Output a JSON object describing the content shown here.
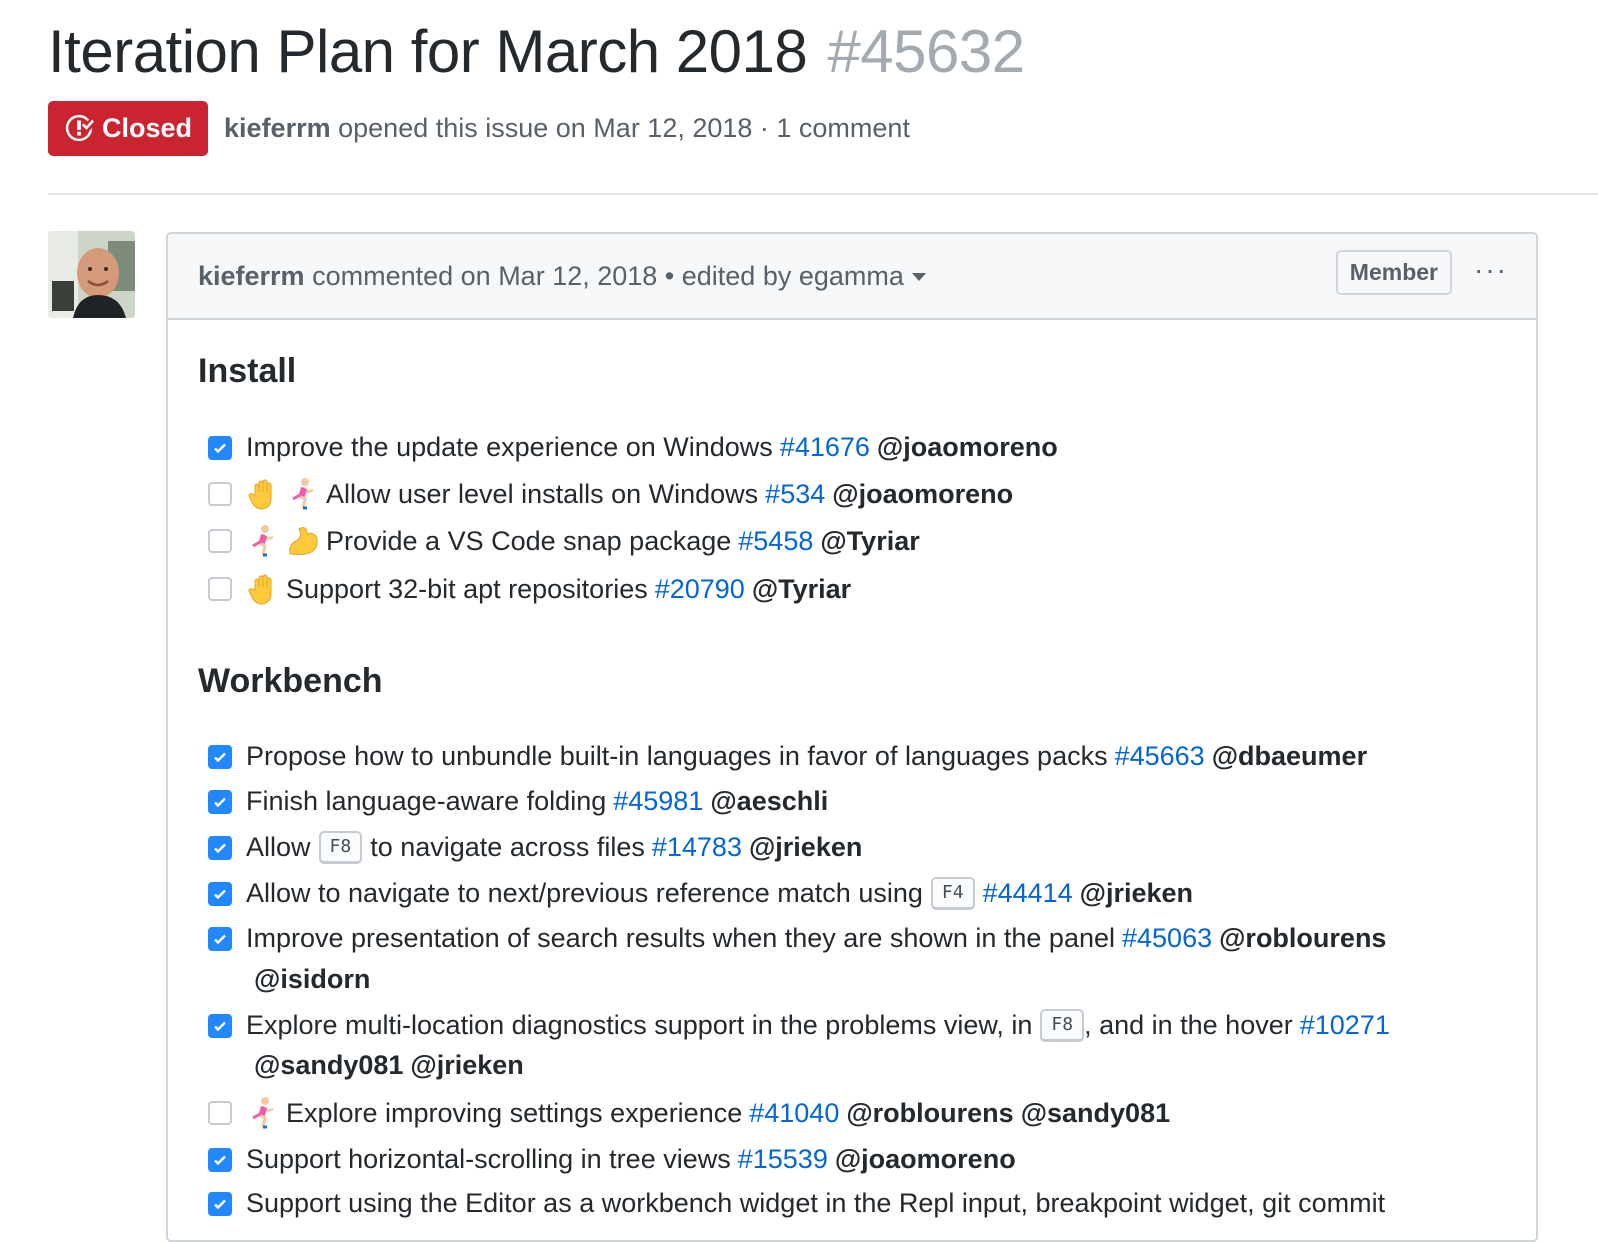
{
  "issue": {
    "title": "Iteration Plan for March 2018",
    "number": "#45632",
    "state": "Closed",
    "author": "kieferrm",
    "opened_text": "opened this issue on Mar 12, 2018 · 1 comment"
  },
  "comment": {
    "author": "kieferrm",
    "header_text": "commented on Mar 12, 2018 • edited by egamma",
    "badge": "Member",
    "more_icon": "more-dots-icon"
  },
  "sections": {
    "install": {
      "title": "Install",
      "tasks": [
        {
          "checked": true,
          "text": "Improve the update experience on Windows",
          "issue": "#41676",
          "mentions": [
            "@joaomoreno"
          ]
        },
        {
          "checked": false,
          "emojis": [
            "raised-hand-icon",
            "runner-icon"
          ],
          "text": "Allow user level installs on Windows",
          "issue": "#534",
          "mentions": [
            "@joaomoreno"
          ]
        },
        {
          "checked": false,
          "emojis": [
            "runner-icon",
            "flexed-biceps-icon"
          ],
          "text": "Provide a VS Code snap package",
          "issue": "#5458",
          "mentions": [
            "@Tyriar"
          ]
        },
        {
          "checked": false,
          "emojis": [
            "raised-hand-icon"
          ],
          "text": "Support 32-bit apt repositories",
          "issue": "#20790",
          "mentions": [
            "@Tyriar"
          ]
        }
      ]
    },
    "workbench": {
      "title": "Workbench",
      "tasks": [
        {
          "checked": true,
          "text": "Propose how to unbundle built-in languages in favor of languages packs",
          "issue": "#45663",
          "mentions": [
            "@dbaeumer"
          ]
        },
        {
          "checked": true,
          "text": "Finish language-aware folding",
          "issue": "#45981",
          "mentions": [
            "@aeschli"
          ]
        },
        {
          "checked": true,
          "text_before": "Allow",
          "key": "F8",
          "text_after": "to navigate across files",
          "issue": "#14783",
          "mentions": [
            "@jrieken"
          ]
        },
        {
          "checked": true,
          "text": "Allow to navigate to next/previous reference match using",
          "key": "F4",
          "issue": "#44414",
          "mentions": [
            "@jrieken"
          ]
        },
        {
          "checked": true,
          "text": "Improve presentation of search results when they are shown in the panel",
          "issue": "#45063",
          "mentions": [
            "@roblourens",
            "@isidorn"
          ]
        },
        {
          "checked": true,
          "text_before": "Explore multi-location diagnostics support in the problems view, in",
          "key": "F8",
          "text_after": ", and in the hover",
          "issue": "#10271",
          "mentions": [
            "@sandy081",
            "@jrieken"
          ]
        },
        {
          "checked": false,
          "emojis": [
            "runner-icon"
          ],
          "text": "Explore improving settings experience",
          "issue": "#41040",
          "mentions": [
            "@roblourens",
            "@sandy081"
          ]
        },
        {
          "checked": true,
          "text": "Support horizontal-scrolling in tree views",
          "issue": "#15539",
          "mentions": [
            "@joaomoreno"
          ]
        },
        {
          "checked": true,
          "text": "Support using the Editor as a workbench widget in the Repl input, breakpoint widget, git commit"
        }
      ]
    }
  },
  "colors": {
    "closed_red": "#cb2431",
    "link_blue": "#0366d6",
    "checkbox_blue": "#2188ff"
  }
}
